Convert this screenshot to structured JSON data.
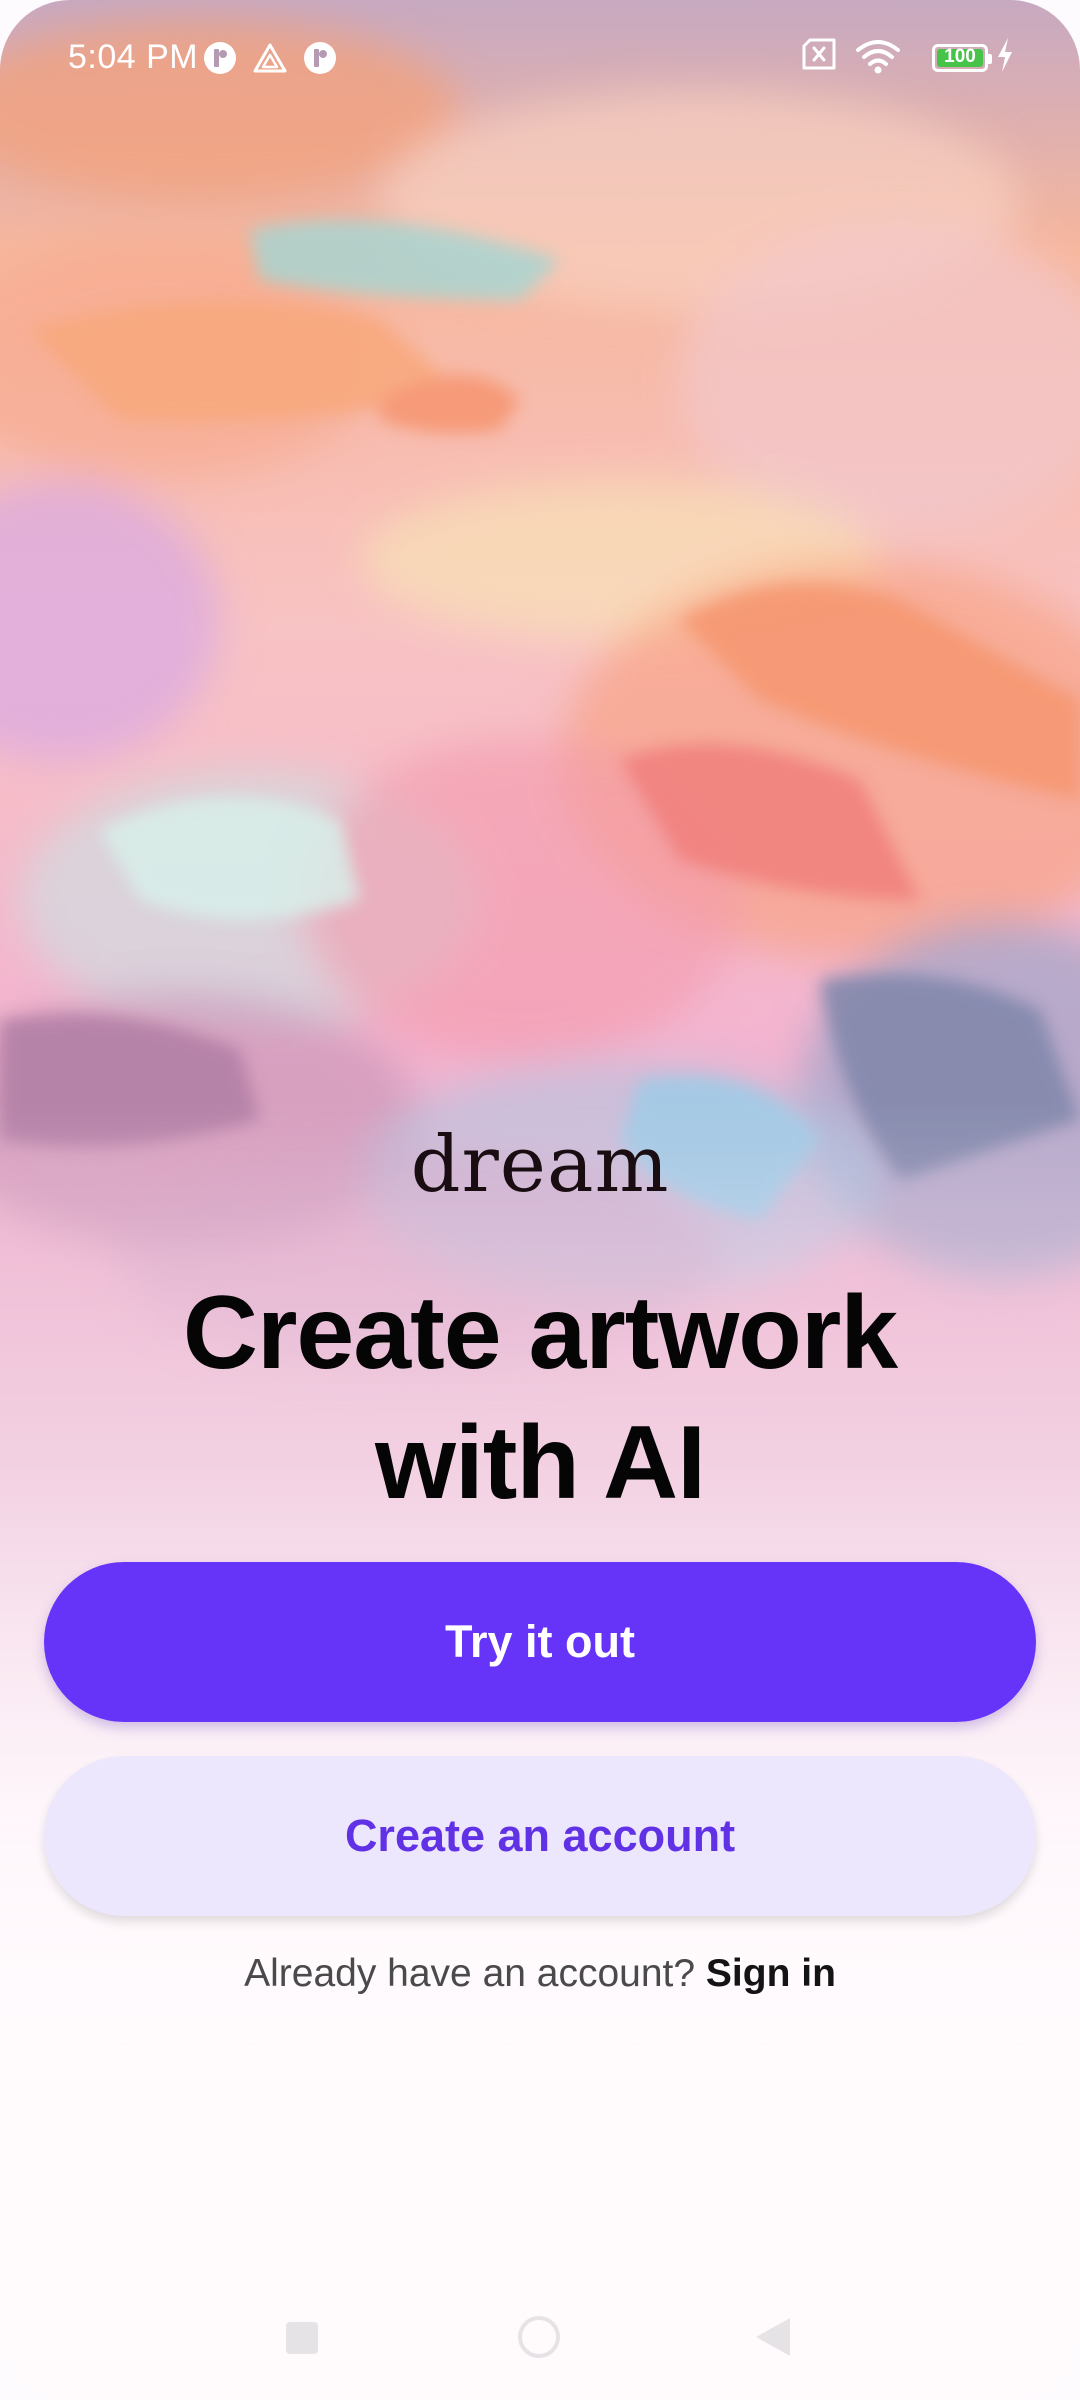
{
  "status_bar": {
    "time": "5:04 PM",
    "battery_level": "100",
    "icons": [
      "notification-app-icon",
      "warning-triangle-icon",
      "notification-app-icon",
      "sim-off-icon",
      "wifi-icon",
      "battery-icon",
      "charging-icon"
    ]
  },
  "brand": {
    "logo_text": "dream"
  },
  "hero": {
    "line1": "Create artwork",
    "line2": "with AI"
  },
  "actions": {
    "primary_label": "Try it out",
    "secondary_label": "Create an account"
  },
  "signin": {
    "prompt": "Already have an account? ",
    "link": "Sign in"
  },
  "colors": {
    "primary": "#6634f9",
    "secondary_bg": "#ece7fc",
    "secondary_text": "#6131e6"
  },
  "nav": {
    "icons": [
      "recents-square-icon",
      "home-circle-icon",
      "back-triangle-icon"
    ]
  }
}
